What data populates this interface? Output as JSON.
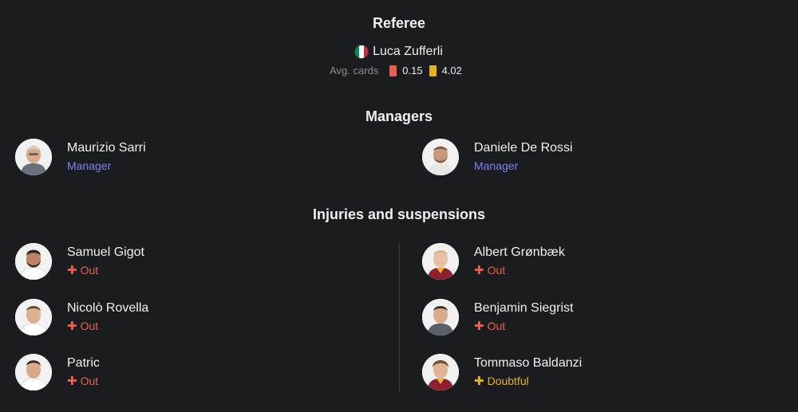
{
  "referee": {
    "title": "Referee",
    "name": "Luca Zufferli",
    "flag_colors": [
      "#009246",
      "#ffffff",
      "#ce2b37"
    ],
    "avg_cards_label": "Avg. cards",
    "red_avg": "0.15",
    "yellow_avg": "4.02",
    "red_color": "#e8604c",
    "yellow_color": "#e6b21a"
  },
  "managers": {
    "title": "Managers",
    "home": {
      "name": "Maurizio Sarri",
      "role": "Manager"
    },
    "away": {
      "name": "Daniele De Rossi",
      "role": "Manager"
    }
  },
  "injuries": {
    "title": "Injuries and suspensions",
    "home": [
      {
        "name": "Samuel Gigot",
        "status": "Out"
      },
      {
        "name": "Nicolò Rovella",
        "status": "Out"
      },
      {
        "name": "Patric",
        "status": "Out"
      }
    ],
    "away": [
      {
        "name": "Albert Grønbæk",
        "status": "Out"
      },
      {
        "name": "Benjamin Siegrist",
        "status": "Out"
      },
      {
        "name": "Tommaso Baldanzi",
        "status": "Doubtful"
      }
    ]
  },
  "icons": {
    "status_out": "plus-cross-icon",
    "status_doubtful": "plus-cross-icon"
  }
}
